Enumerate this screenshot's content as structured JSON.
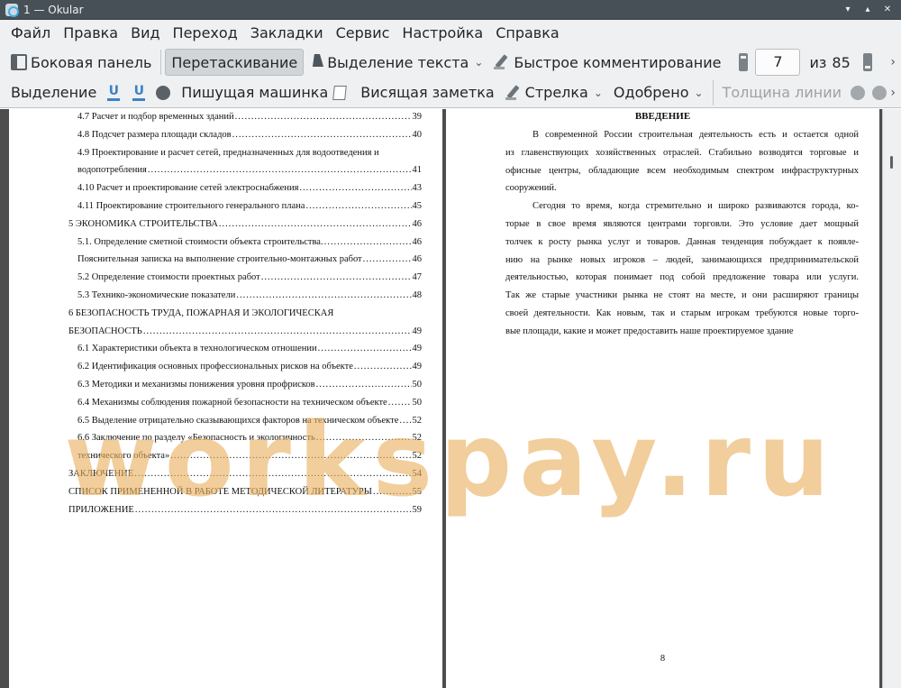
{
  "window": {
    "title": "1  — Okular"
  },
  "menubar": {
    "items": [
      "Файл",
      "Правка",
      "Вид",
      "Переход",
      "Закладки",
      "Сервис",
      "Настройка",
      "Справка"
    ]
  },
  "toolbar": {
    "sidebar_label": "Боковая панель",
    "browse_label": "Перетаскивание",
    "text_selection_label": "Выделение текста",
    "quick_annotations_label": "Быстрое комментирование",
    "current_page": "7",
    "of_label": "из",
    "total_pages": "85"
  },
  "annotation_toolbar": {
    "highlight_label": "Выделение",
    "typewriter_label": "Пишущая машинка",
    "popup_note_label": "Висящая заметка",
    "arrow_label": "Стрелка",
    "stamp_label": "Одобрено",
    "line_width_label": "Толщина линии"
  },
  "left_page": {
    "toc": [
      {
        "title": "4.7 Расчет и подбор временных зданий",
        "page": "39",
        "level": 2
      },
      {
        "title": "4.8 Подсчет размера площади складов",
        "page": "40",
        "level": 2
      },
      {
        "title": "4.9 Проектирование и расчет сетей, предназначенных для водоотведения и",
        "page": "",
        "level": 2
      },
      {
        "title": "водопотребления",
        "page": "41",
        "level": 2
      },
      {
        "title": "4.10 Расчет и проектирование сетей электроснабжения",
        "page": "43",
        "level": 2
      },
      {
        "title": "4.11 Проектирование строительного генерального плана",
        "page": "45",
        "level": 2
      },
      {
        "title": "5 ЭКОНОМИКА СТРОИТЕЛЬСТВА",
        "page": "46",
        "level": 1
      },
      {
        "title": "5.1. Определение сметной стоимости объекта строительства.",
        "page": "46",
        "level": 2
      },
      {
        "title": "Пояснительная записка на выполнение строительно-монтажных работ",
        "page": "46",
        "level": 2
      },
      {
        "title": "5.2 Определение стоимости проектных работ",
        "page": "47",
        "level": 2
      },
      {
        "title": "5.3 Технико-экономические показатели",
        "page": "48",
        "level": 2
      },
      {
        "title": "6 БЕЗОПАСНОСТЬ ТРУДА, ПОЖАРНАЯ И ЭКОЛОГИЧЕСКАЯ",
        "page": "",
        "level": 1
      },
      {
        "title": "БЕЗОПАСНОСТЬ",
        "page": "49",
        "level": 1
      },
      {
        "title": "6.1 Характеристики объекта в технологическом отношении",
        "page": "49",
        "level": 2
      },
      {
        "title": "6.2 Идентификация основных профессиональных рисков на объекте",
        "page": "49",
        "level": 2
      },
      {
        "title": "6.3 Методики и механизмы понижения уровня профрисков",
        "page": "50",
        "level": 2
      },
      {
        "title": "6.4 Механизмы соблюдения пожарной безопасности на техническом объекте",
        "page": "50",
        "level": 2
      },
      {
        "title": "6.5 Выделение отрицательно сказывающихся факторов на техническом объекте",
        "page": "52",
        "level": 2
      },
      {
        "title": "6.6 Заключение по разделу «Безопасность и экологичность",
        "page": "52",
        "level": 2
      },
      {
        "title": "технического объекта»",
        "page": "52",
        "level": 2
      },
      {
        "title": "ЗАКЛЮЧЕНИЕ",
        "page": "54",
        "level": 1
      },
      {
        "title": "СПИСОК ПРИМЕНЕННОЙ В РАБОТЕ МЕТОДИЧЕСКОЙ ЛИТЕРАТУРЫ",
        "page": "55",
        "level": 1
      },
      {
        "title": "ПРИЛОЖЕНИЕ",
        "page": "59",
        "level": 1
      }
    ]
  },
  "right_page": {
    "heading": "ВВЕДЕНИЕ",
    "lines": [
      "В современной России строительная деятельность есть и остается одной",
      "из главенствующих хозяйственных отраслей. Стабильно возводятся торговые и",
      "офисные центры, обладающие всем необходимым спектром инфраструктурных",
      "сооружений.",
      "Сегодня то время, когда стремительно и широко развиваются города, ко-",
      "торые в свое время являются центрами торговли. Это условие дает мощный",
      "толчек к росту рынка услуг и товаров. Данная тенденция побуждает к появле-",
      "нию на рынке новых игроков – людей, занимающихся предпринимательской",
      "деятельностью, которая понимает под собой предложение товара или услуги.",
      "Так же старые участники рынка не стоят на месте, и они расширяют границы",
      "своей деятельности. Как новым, так и старым игрокам требуются новые торго-",
      "вые площади, какие и может предоставить наше проектируемое здание"
    ],
    "page_number": "8"
  },
  "watermark": "workspay.ru"
}
